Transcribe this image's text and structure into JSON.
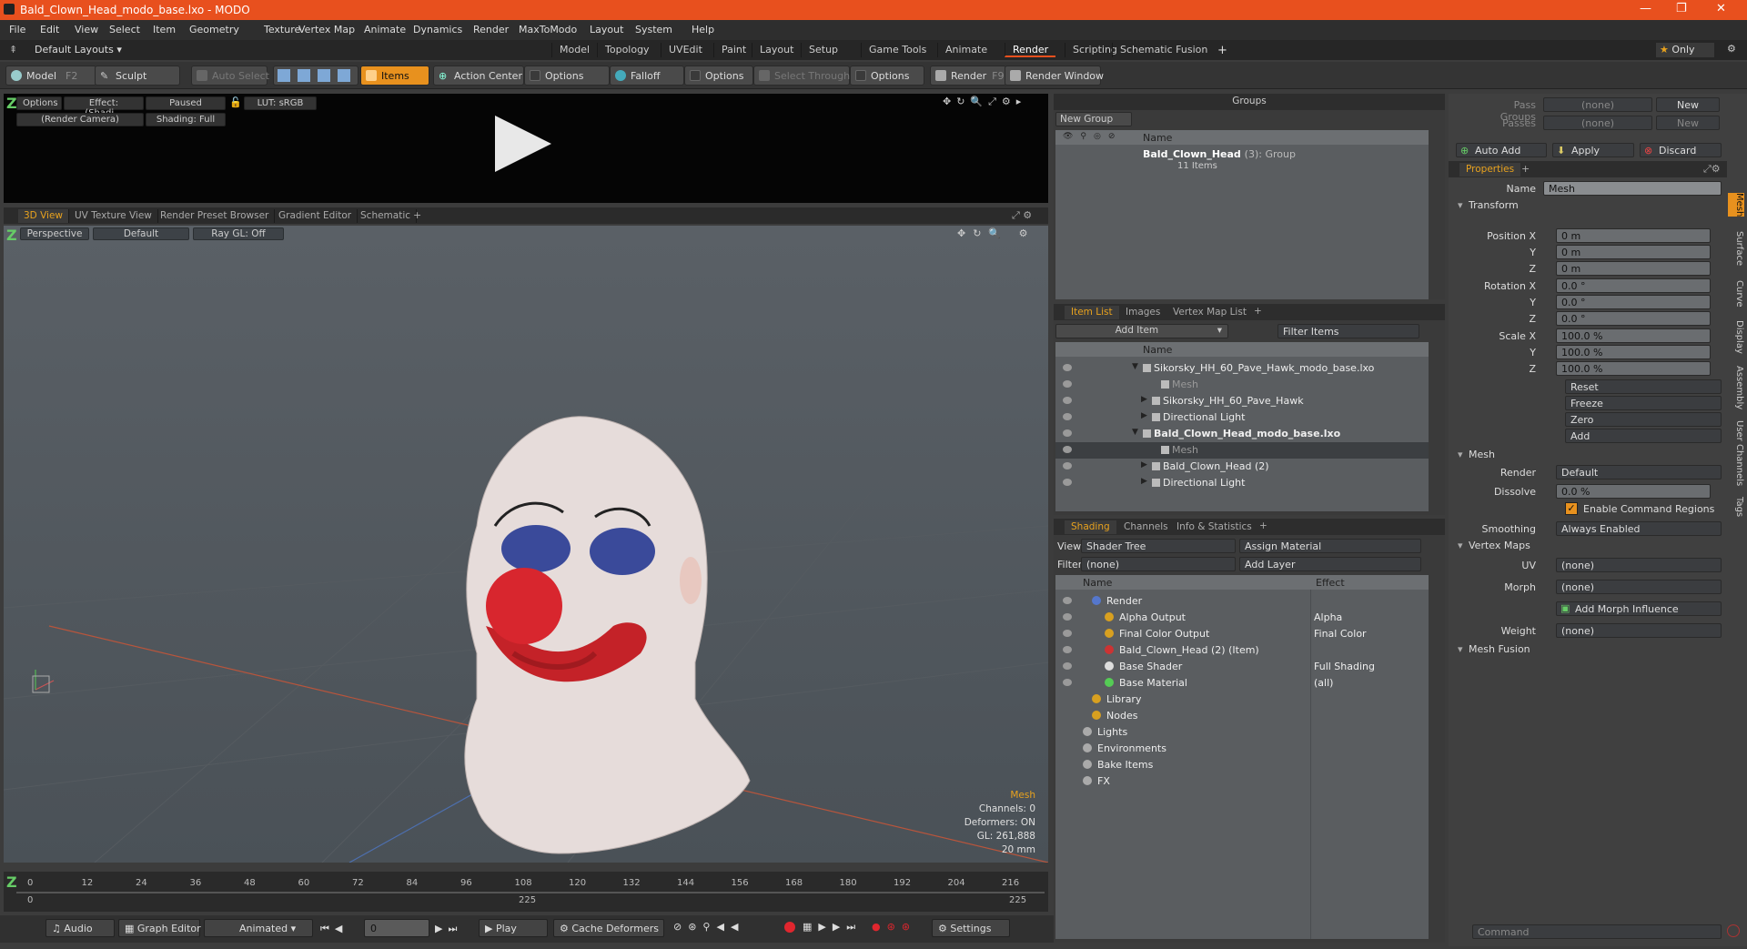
{
  "window": {
    "title": "Bald_Clown_Head_modo_base.lxo - MODO"
  },
  "menu": [
    "File",
    "Edit",
    "View",
    "Select",
    "Item",
    "Geometry",
    "Texture",
    "Vertex Map",
    "Animate",
    "Dynamics",
    "Render",
    "MaxToModo",
    "Layout",
    "System",
    "Help"
  ],
  "layouts": {
    "preset": "Default Layouts",
    "tabs": [
      "Model",
      "Topology",
      "UVEdit",
      "Paint",
      "Layout",
      "Setup",
      "Game Tools",
      "Animate",
      "Render",
      "Scripting",
      "Schematic Fusion"
    ],
    "active": "Render",
    "only": "Only"
  },
  "toolbar": {
    "model": "Model",
    "model_key": "F2",
    "sculpt": "Sculpt",
    "auto_select": "Auto Select",
    "items": "Items",
    "action_center": "Action Center",
    "options": "Options",
    "falloff": "Falloff",
    "options2": "Options",
    "select_through": "Select Through",
    "options3": "Options",
    "render": "Render",
    "render_key": "F9",
    "render_window": "Render Window"
  },
  "preview": {
    "options": "Options",
    "effect": "Effect: (Shadi...",
    "paused": "Paused",
    "lut": "LUT: sRGB",
    "camera": "(Render Camera)",
    "shading": "Shading: Full"
  },
  "viewtabs": [
    "3D View",
    "UV Texture View",
    "Render Preset Browser",
    "Gradient Editor",
    "Schematic"
  ],
  "viewport": {
    "perspective": "Perspective",
    "default": "Default",
    "raygl": "Ray GL: Off",
    "stats": {
      "type": "Mesh",
      "channels": "Channels: 0",
      "deformers": "Deformers: ON",
      "gl": "GL: 261,888",
      "dist": "20 mm"
    }
  },
  "timeline": {
    "ticks": [
      "0",
      "12",
      "24",
      "36",
      "48",
      "60",
      "72",
      "84",
      "96",
      "108",
      "120",
      "132",
      "144",
      "156",
      "168",
      "180",
      "192",
      "204",
      "216"
    ],
    "end1": "225",
    "end2": "225",
    "start": "0"
  },
  "transport": {
    "audio": "Audio",
    "graph": "Graph Editor",
    "animated": "Animated",
    "frame": "0",
    "play": "Play",
    "cache": "Cache Deformers",
    "settings": "Settings"
  },
  "groups": {
    "title": "Groups",
    "new_group": "New Group",
    "name_col": "Name",
    "item": "Bald_Clown_Head",
    "count": "(3)",
    "kind": ": Group",
    "sub": "11 Items"
  },
  "itemlist": {
    "tabs": [
      "Item List",
      "Images",
      "Vertex Map List"
    ],
    "add_item": "Add Item",
    "filter": "Filter Items",
    "name_col": "Name",
    "rows": [
      {
        "label": "Sikorsky_HH_60_Pave_Hawk_modo_base.lxo",
        "indent": 0,
        "bold": false
      },
      {
        "label": "Mesh",
        "indent": 2,
        "bold": false,
        "dim": true
      },
      {
        "label": "Sikorsky_HH_60_Pave_Hawk",
        "indent": 1,
        "bold": false
      },
      {
        "label": "Directional Light",
        "indent": 1,
        "bold": false
      },
      {
        "label": "Bald_Clown_Head_modo_base.lxo",
        "indent": 0,
        "bold": true
      },
      {
        "label": "Mesh",
        "indent": 2,
        "bold": false,
        "dim": true,
        "sel": true
      },
      {
        "label": "Bald_Clown_Head (2)",
        "indent": 1,
        "bold": false
      },
      {
        "label": "Directional Light",
        "indent": 1,
        "bold": false
      }
    ]
  },
  "shading": {
    "tabs": [
      "Shading",
      "Channels",
      "Info & Statistics"
    ],
    "view_lbl": "View",
    "view": "Shader Tree",
    "assign": "Assign Material",
    "filter_lbl": "Filter",
    "filter": "(none)",
    "add_layer": "Add Layer",
    "name_col": "Name",
    "effect_col": "Effect",
    "rows": [
      {
        "label": "Render",
        "effect": "",
        "indent": 0
      },
      {
        "label": "Alpha Output",
        "effect": "Alpha",
        "indent": 1
      },
      {
        "label": "Final Color Output",
        "effect": "Final Color",
        "indent": 1
      },
      {
        "label": "Bald_Clown_Head (2) (Item)",
        "effect": "",
        "indent": 1
      },
      {
        "label": "Base Shader",
        "effect": "Full Shading",
        "indent": 1
      },
      {
        "label": "Base Material",
        "effect": "(all)",
        "indent": 1
      },
      {
        "label": "Library",
        "effect": "",
        "indent": 0
      },
      {
        "label": "Nodes",
        "effect": "",
        "indent": 0
      },
      {
        "label": "Lights",
        "effect": "",
        "indent": -1
      },
      {
        "label": "Environments",
        "effect": "",
        "indent": -1
      },
      {
        "label": "Bake Items",
        "effect": "",
        "indent": -1
      },
      {
        "label": "FX",
        "effect": "",
        "indent": -1
      }
    ]
  },
  "right": {
    "pass_groups": "Pass Groups",
    "passes": "Passes",
    "none": "(none)",
    "new": "New",
    "auto_add": "Auto Add",
    "apply": "Apply",
    "discard": "Discard",
    "properties": "Properties",
    "name_lbl": "Name",
    "name": "Mesh",
    "transform": "Transform",
    "pos": [
      "0 m",
      "0 m",
      "0 m"
    ],
    "rot": [
      "0.0 °",
      "0.0 °",
      "0.0 °"
    ],
    "scale": [
      "100.0 %",
      "100.0 %",
      "100.0 %"
    ],
    "pos_lbl": "Position X",
    "rot_lbl": "Rotation X",
    "scale_lbl": "Scale X",
    "y": "Y",
    "z": "Z",
    "reset": "Reset",
    "freeze": "Freeze",
    "zero": "Zero",
    "add": "Add",
    "mesh": "Mesh",
    "render_lbl": "Render",
    "render": "Default",
    "dissolve_lbl": "Dissolve",
    "dissolve": "0.0 %",
    "enable_cmd": "Enable Command Regions",
    "smoothing_lbl": "Smoothing",
    "smoothing": "Always Enabled",
    "vertex_maps": "Vertex Maps",
    "uv_lbl": "UV",
    "uv": "(none)",
    "morph_lbl": "Morph",
    "morph": "(none)",
    "add_morph": "Add Morph Influence",
    "weight_lbl": "Weight",
    "weight": "(none)",
    "mesh_fusion": "Mesh Fusion",
    "command": "Command",
    "sidetabs": [
      "Mesh",
      "Surface",
      "Curve",
      "Display",
      "Assembly",
      "User Channels",
      "Tags"
    ]
  }
}
